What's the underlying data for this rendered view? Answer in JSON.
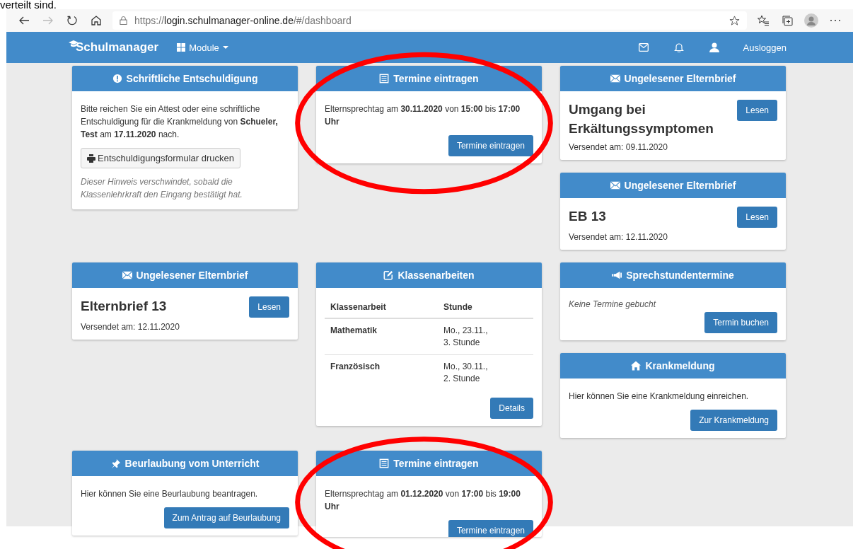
{
  "caption": "verteilt sind.",
  "browser": {
    "url_scheme": "https://",
    "url_host": "login.schulmanager-online.de",
    "url_path": "/#/dashboard"
  },
  "navbar": {
    "brand": "Schulmanager",
    "menu": "Module",
    "logout": "Ausloggen"
  },
  "rows": [
    {
      "cells": [
        {
          "cards": [
            {
              "kind": "excuse",
              "circled": false,
              "title": "Schriftliche Entschuldigung",
              "text": "Bitte reichen Sie ein Attest oder eine schriftliche Entschuldigung für die Krankmeldung von **Schueler, Test** am **17.11.2020** nach.",
              "button": "Entschuldigungsformular drucken",
              "note": "Dieser Hinweis verschwindet, sobald die Klassenlehrkraft den Eingang bestätigt hat."
            }
          ]
        },
        {
          "cards": [
            {
              "kind": "appointment",
              "circled": true,
              "title": "Termine eintragen",
              "text": "Elternsprechtag am **30.11.2020** von **15:00** bis **17:00 Uhr**",
              "button": "Termine eintragen"
            }
          ]
        },
        {
          "cards": [
            {
              "kind": "letter",
              "circled": false,
              "title": "Ungelesener Elternbrief",
              "heading": "Umgang bei Erkältungssymptomen",
              "button": "Lesen",
              "sent": "Versendet am: 09.11.2020"
            },
            {
              "kind": "letter",
              "circled": false,
              "title": "Ungelesener Elternbrief",
              "heading": "EB 13",
              "button": "Lesen",
              "sent": "Versendet am: 12.11.2020"
            }
          ]
        }
      ]
    },
    {
      "cells": [
        {
          "cards": [
            {
              "kind": "letter",
              "circled": false,
              "title": "Ungelesener Elternbrief",
              "heading": "Elternbrief 13",
              "button": "Lesen",
              "sent": "Versendet am: 12.11.2020"
            }
          ]
        },
        {
          "cards": [
            {
              "kind": "exams",
              "circled": false,
              "title": "Klassenarbeiten",
              "columns": [
                "Klassenarbeit",
                "Stunde"
              ],
              "rows": [
                [
                  "Mathematik",
                  "Mo., 23.11., 3. Stunde"
                ],
                [
                  "Französisch",
                  "Mo., 30.11., 2. Stunde"
                ]
              ],
              "button": "Details"
            }
          ]
        },
        {
          "cards": [
            {
              "kind": "consultation",
              "circled": false,
              "title": "Sprechstundentermine",
              "note": "Keine Termine gebucht",
              "button": "Termin buchen"
            },
            {
              "kind": "sickness",
              "circled": false,
              "title": "Krankmeldung",
              "text": "Hier können Sie eine Krankmeldung einreichen.",
              "button": "Zur Krankmeldung"
            }
          ]
        }
      ]
    },
    {
      "cells": [
        {
          "cards": [
            {
              "kind": "leave",
              "circled": false,
              "title": "Beurlaubung vom Unterricht",
              "text": "Hier können Sie eine Beurlaubung beantragen.",
              "button": "Zum Antrag auf Beurlaubung"
            }
          ]
        },
        {
          "cards": [
            {
              "kind": "appointment",
              "circled": true,
              "title": "Termine eintragen",
              "text": "Elternsprechtag am **01.12.2020** von **17:00** bis **19:00 Uhr**",
              "button": "Termine eintragen"
            }
          ]
        }
      ]
    }
  ]
}
